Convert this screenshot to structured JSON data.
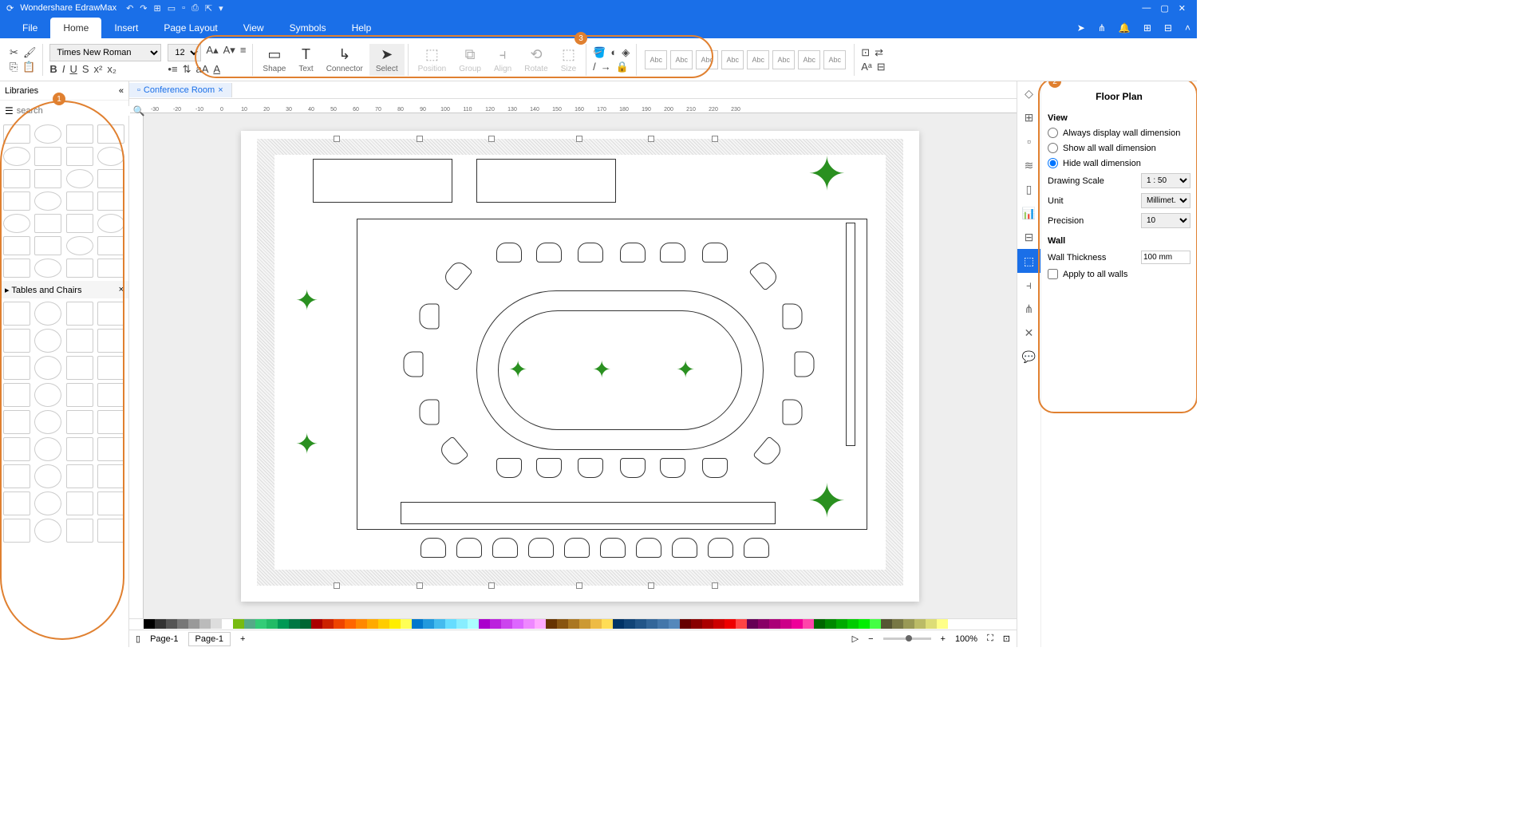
{
  "title": "Wondershare EdrawMax",
  "menu": [
    "File",
    "Home",
    "Insert",
    "Page Layout",
    "View",
    "Symbols",
    "Help"
  ],
  "active_menu": "Home",
  "font": "Times New Roman",
  "font_size": "12",
  "ribbon_tools": [
    "Shape",
    "Text",
    "Connector",
    "Select",
    "Position",
    "Group",
    "Align",
    "Rotate",
    "Size"
  ],
  "style_label": "Abc",
  "doc_tab": "Conference Room",
  "libraries_label": "Libraries",
  "search_placeholder": "search",
  "shape_category": "Tables and Chairs",
  "page_label": "Page-1",
  "ruler_marks": [
    "-30",
    "-20",
    "-10",
    "0",
    "10",
    "20",
    "30",
    "40",
    "50",
    "60",
    "70",
    "80",
    "90",
    "100",
    "110",
    "120",
    "130",
    "140",
    "150",
    "160",
    "170",
    "180",
    "190",
    "200",
    "210",
    "220",
    "230"
  ],
  "zoom": "100%",
  "right_panel": {
    "title": "Floor Plan",
    "view_section": "View",
    "view_options": [
      "Always display wall dimension",
      "Show all wall dimension",
      "Hide wall dimension"
    ],
    "scale_label": "Drawing Scale",
    "scale_value": "1 : 50",
    "unit_label": "Unit",
    "unit_value": "Millimet...",
    "precision_label": "Precision",
    "precision_value": "10",
    "wall_section": "Wall",
    "thickness_label": "Wall Thickness",
    "thickness_value": "100 mm",
    "apply_label": "Apply to all walls"
  },
  "colors": [
    "#000",
    "#333",
    "#555",
    "#777",
    "#999",
    "#bbb",
    "#ddd",
    "#fff",
    "#7b1",
    "#5a8",
    "#3c7",
    "#2b6",
    "#095",
    "#074",
    "#063",
    "#a00",
    "#c20",
    "#e40",
    "#f60",
    "#f80",
    "#fa0",
    "#fc0",
    "#fe0",
    "#ff5",
    "#07c",
    "#29d",
    "#4be",
    "#6df",
    "#8ef",
    "#aff",
    "#a0c",
    "#b2d",
    "#c4e",
    "#d6f",
    "#e8f",
    "#faf",
    "#630",
    "#851",
    "#a72",
    "#c93",
    "#eb4",
    "#fd5",
    "#036",
    "#147",
    "#258",
    "#369",
    "#47a",
    "#58b",
    "#600",
    "#800",
    "#a00",
    "#c00",
    "#e00",
    "#f44",
    "#605",
    "#806",
    "#a07",
    "#c08",
    "#e09",
    "#f4a",
    "#060",
    "#080",
    "#0a0",
    "#0c0",
    "#0e0",
    "#4f4",
    "#553",
    "#774",
    "#995",
    "#bb6",
    "#dd7",
    "#ff8"
  ]
}
